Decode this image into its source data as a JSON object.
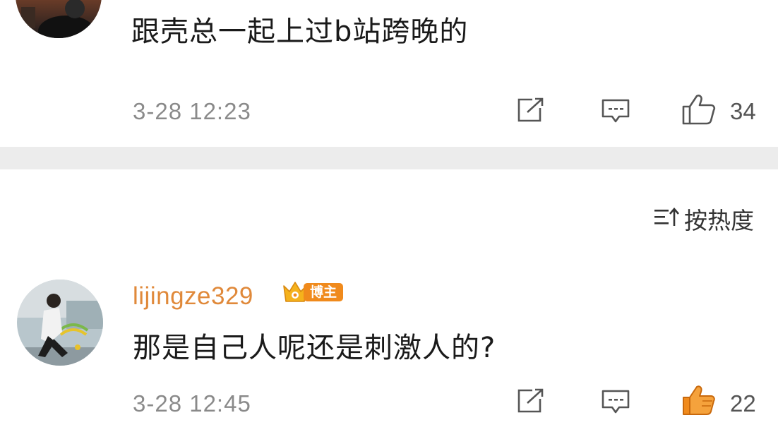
{
  "comments": [
    {
      "username": "",
      "text": "跟壳总一起上过b站跨晚的",
      "timestamp": "3-28 12:23",
      "like_count": "34",
      "liked": false
    },
    {
      "username": "lijingze329",
      "badge": "博主",
      "text": "那是自己人呢还是刺激人的?",
      "timestamp": "3-28 12:45",
      "like_count": "22",
      "liked": true
    }
  ],
  "sort": {
    "label": "按热度"
  },
  "icons": {
    "share": "share-icon",
    "comment": "comment-icon",
    "like": "thumbs-up-icon",
    "sort": "sort-icon",
    "badge": "crown-badge-icon"
  },
  "colors": {
    "username": "#e0893a",
    "like_active": "#f08a1c",
    "badge": "#f08a1c",
    "divider": "#ececec"
  }
}
